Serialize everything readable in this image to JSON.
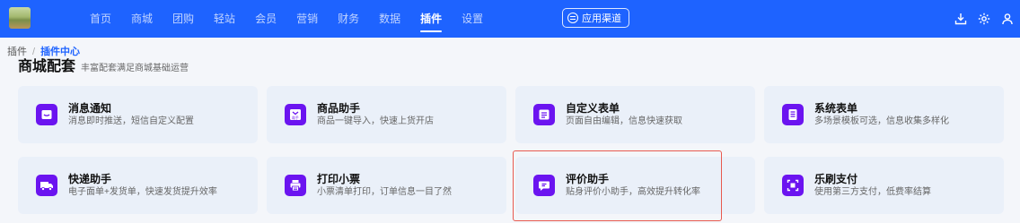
{
  "topbar": {
    "nav": [
      {
        "label": "首页",
        "name": "nav-home"
      },
      {
        "label": "商城",
        "name": "nav-mall"
      },
      {
        "label": "团购",
        "name": "nav-groupbuy"
      },
      {
        "label": "轻站",
        "name": "nav-lite-site"
      },
      {
        "label": "会员",
        "name": "nav-member"
      },
      {
        "label": "营销",
        "name": "nav-marketing"
      },
      {
        "label": "财务",
        "name": "nav-finance"
      },
      {
        "label": "数据",
        "name": "nav-data"
      },
      {
        "label": "插件",
        "name": "nav-plugins",
        "active": true
      },
      {
        "label": "设置",
        "name": "nav-settings"
      }
    ],
    "channel_button": "应用渠道",
    "accent": "#1e63ff"
  },
  "breadcrumb": {
    "root": "插件",
    "separator": "/",
    "current": "插件中心"
  },
  "section": {
    "title": "商城配套",
    "subtitle": "丰富配套满足商城基础运营"
  },
  "cards": [
    {
      "name": "消息通知",
      "desc": "消息即时推送，短信自定义配置",
      "icon": "message-icon"
    },
    {
      "name": "商品助手",
      "desc": "商品一键导入，快速上货开店",
      "icon": "product-assistant-icon",
      "icon_text": "助手"
    },
    {
      "name": "自定义表单",
      "desc": "页面自由编辑，信息快速获取",
      "icon": "form-icon"
    },
    {
      "name": "系统表单",
      "desc": "多场景模板可选，信息收集多样化",
      "icon": "system-form-icon"
    },
    {
      "name": "快递助手",
      "desc": "电子面单+发货单，快速发货提升效率",
      "icon": "truck-icon"
    },
    {
      "name": "打印小票",
      "desc": "小票清单打印，订单信息一目了然",
      "icon": "printer-icon"
    },
    {
      "name": "评价助手",
      "desc": "贴身评价小助手，高效提升转化率",
      "icon": "review-icon",
      "highlighted": true
    },
    {
      "name": "乐刷支付",
      "desc": "使用第三方支付，低费率结算",
      "icon": "scan-pay-icon"
    }
  ],
  "colors": {
    "icon_bg": "#6b14f0",
    "card_bg": "#eaf0f9",
    "highlight_border": "#e85a4f"
  }
}
